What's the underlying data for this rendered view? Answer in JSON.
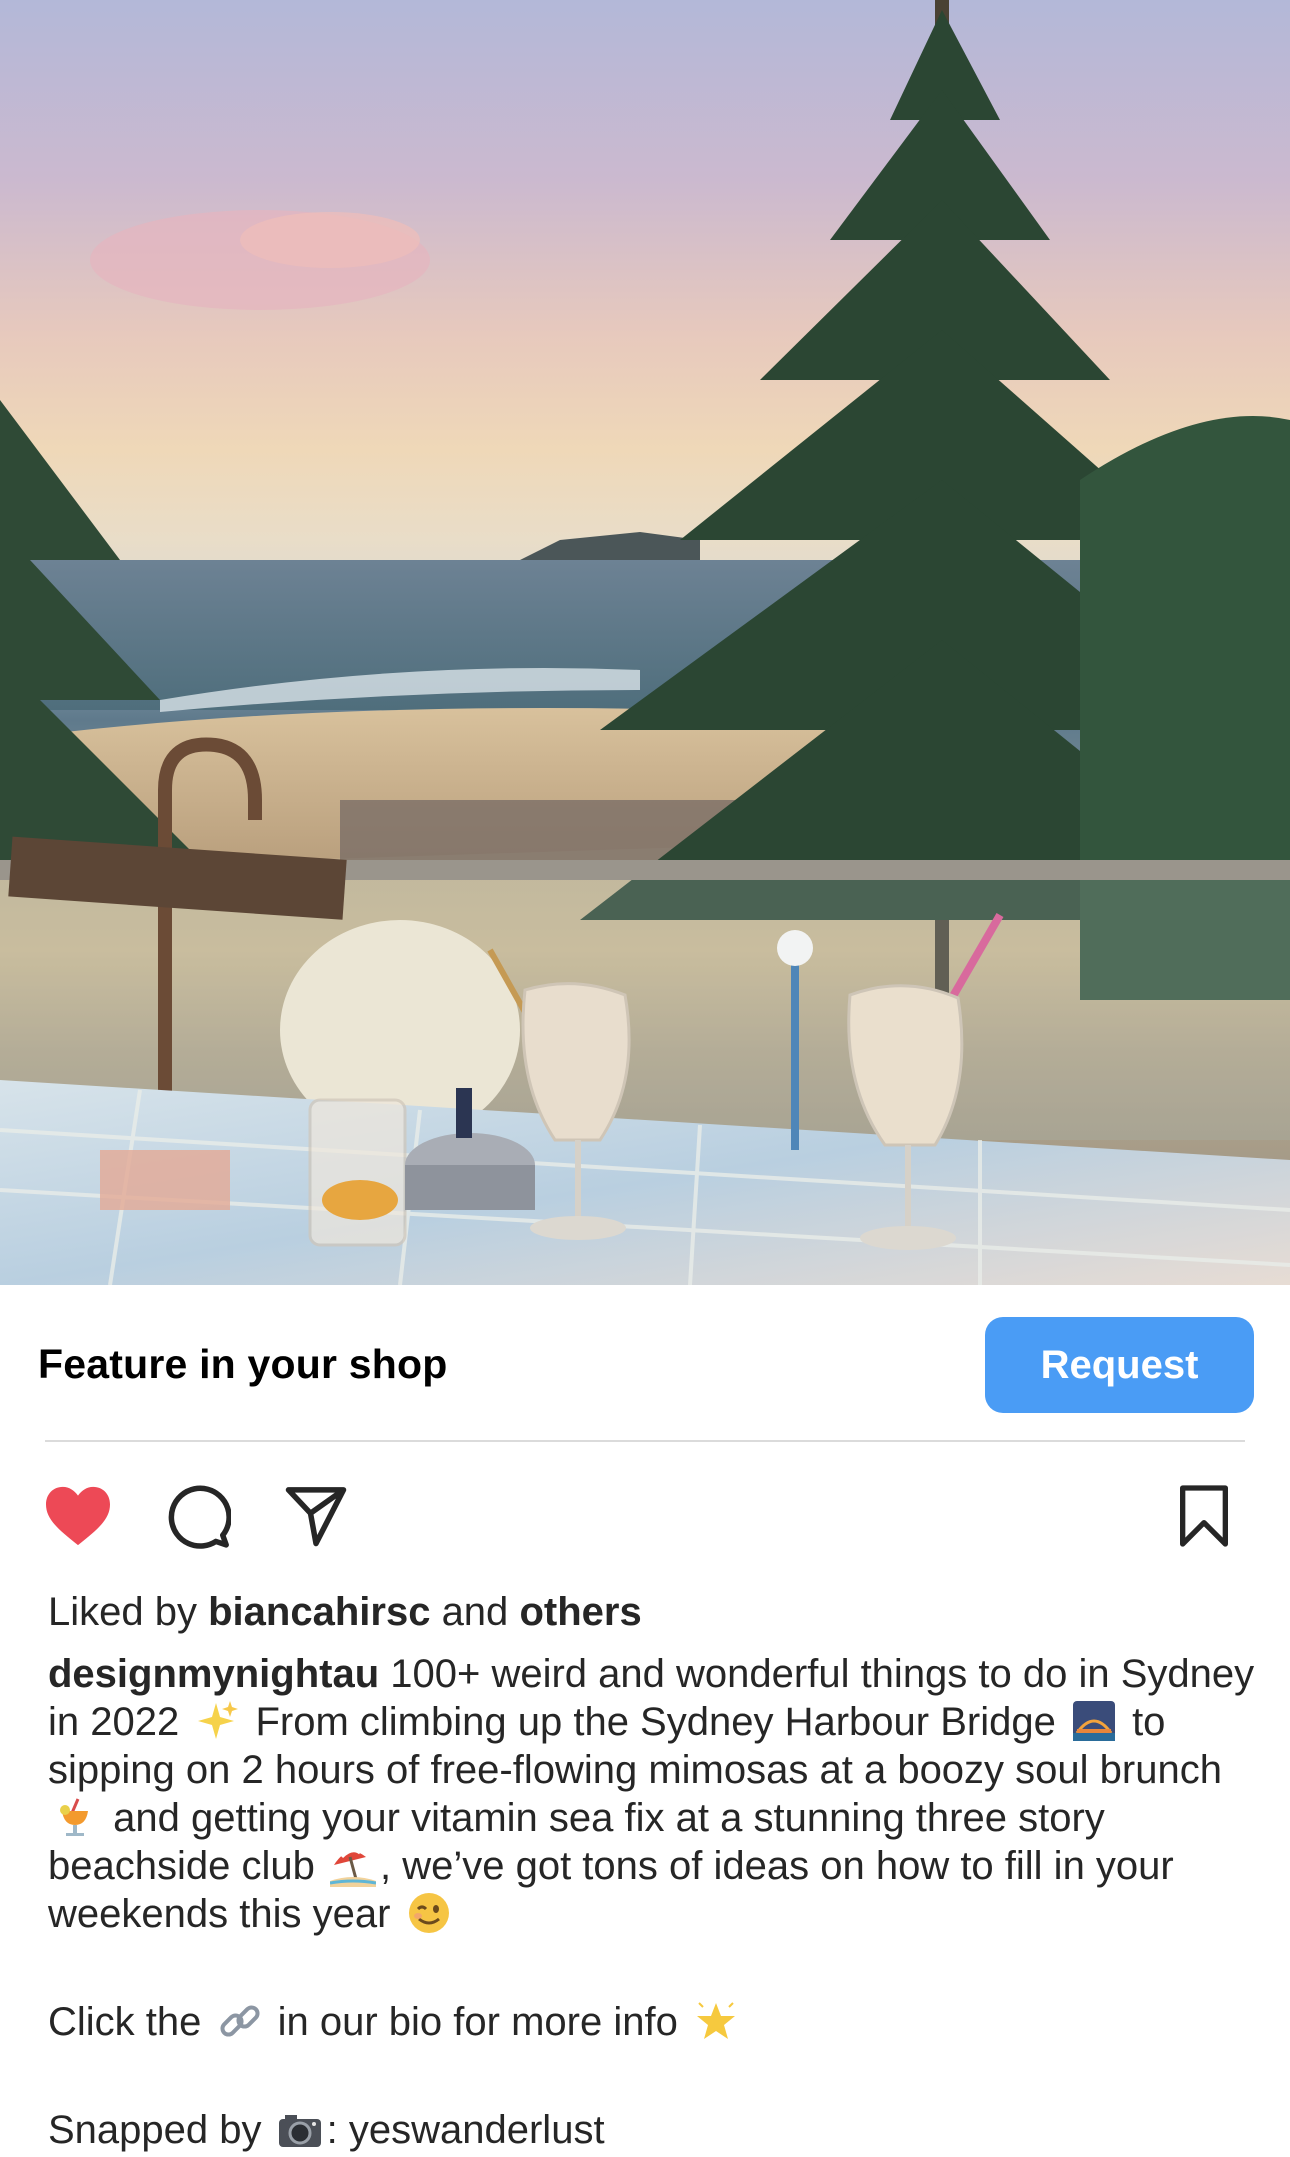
{
  "photo": {
    "alt": ""
  },
  "shop": {
    "title": "Feature in your shop",
    "request_label": "Request"
  },
  "actions": {
    "like_icon": "heart-filled-icon",
    "comment_icon": "comment-icon",
    "share_icon": "send-icon",
    "save_icon": "bookmark-icon",
    "like_color": "#ed4956"
  },
  "likes": {
    "prefix": "Liked by",
    "user": "biancahirsc",
    "middle": "and",
    "others": "others"
  },
  "caption": {
    "username": "designmynightau",
    "p1_a": " 100+ weird and wonderful things to do in Sydney in 2022 ",
    "p1_b": " From climbing up the Sydney Harbour Bridge ",
    "p1_c": " to sipping on 2 hours of free-flowing mimosas at a boozy soul brunch ",
    "p1_d": " and getting your vitamin sea fix at a stunning three story beachside club ",
    "p1_e": ", we’ve got tons of ideas on how to fill in your weekends this year ",
    "p2_a": "Click the ",
    "p2_b": " in our bio for more info ",
    "p3_a": "Snapped by ",
    "p3_b": ": yeswanderlust",
    "emoji": [
      "sparkles-emoji",
      "bridge-at-night-emoji",
      "tropical-drink-emoji",
      "beach-umbrella-emoji",
      "winking-face-emoji",
      "link-emoji",
      "glowing-star-emoji",
      "camera-emoji"
    ]
  }
}
